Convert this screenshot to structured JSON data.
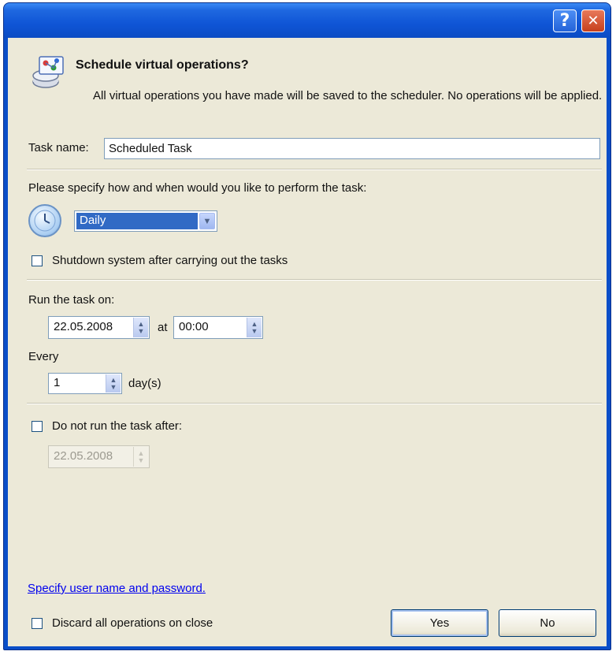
{
  "window": {
    "help_button": "?",
    "close_button": "✕"
  },
  "header": {
    "title": "Schedule virtual operations?",
    "description": "All virtual operations you have made will be saved to the scheduler. No operations will be applied.",
    "icon": "operations-icon"
  },
  "task_name": {
    "label": "Task name:",
    "value": "Scheduled Task"
  },
  "schedule": {
    "prompt": "Please specify how and when would you like to perform the task:",
    "icon": "clock-icon",
    "frequency_selected": "Daily",
    "shutdown_label": "Shutdown system after carrying out the tasks",
    "shutdown_checked": false
  },
  "run": {
    "label": "Run the task on:",
    "date": "22.05.2008",
    "at_label": "at",
    "time": "00:00",
    "every_label": "Every",
    "every_value": "1",
    "every_unit": "day(s)"
  },
  "end": {
    "label": "Do not run the task after:",
    "checked": false,
    "date": "22.05.2008"
  },
  "footer": {
    "credentials_link": "Specify user name and password.",
    "discard_label": "Discard all operations on close",
    "discard_checked": false,
    "yes_button": "Yes",
    "no_button": "No"
  },
  "colors": {
    "title_bar": "#0a4ec8",
    "dialog_bg": "#ece9d8",
    "selection": "#316ac5",
    "close_button": "#c6401c",
    "link": "#0000ee"
  }
}
